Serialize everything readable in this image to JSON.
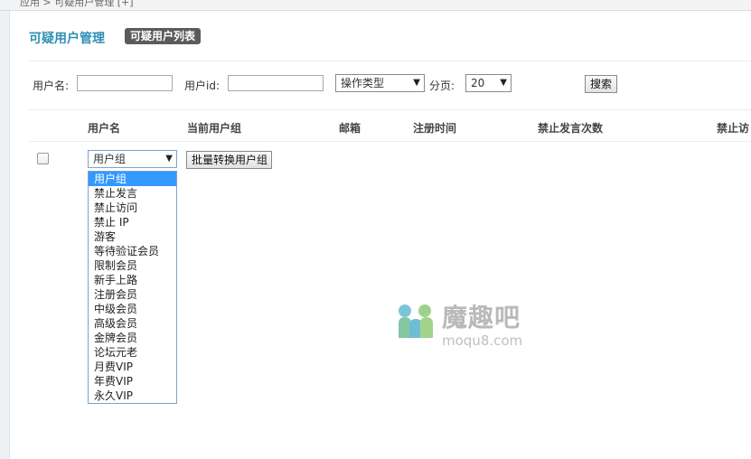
{
  "breadcrumb": "应用 > 可疑用户管理 [+]",
  "header": {
    "title": "可疑用户管理",
    "tab_label": "可疑用户列表"
  },
  "filters": {
    "username_label": "用户名:",
    "username_value": "",
    "userid_label": "用户id:",
    "userid_value": "",
    "op_type_selected": "操作类型",
    "page_label": "分页:",
    "page_size_selected": "20",
    "search_button": "搜索"
  },
  "table": {
    "columns": [
      "用户名",
      "当前用户组",
      "邮箱",
      "注册时间",
      "禁止发言次数",
      "禁止访"
    ]
  },
  "batch": {
    "group_select_value": "用户组",
    "convert_button": "批量转换用户组",
    "group_options": [
      "用户组",
      "禁止发言",
      "禁止访问",
      "禁止 IP",
      "游客",
      "等待验证会员",
      "限制会员",
      "新手上路",
      "注册会员",
      "中级会员",
      "高级会员",
      "金牌会员",
      "论坛元老",
      "月费VIP",
      "年费VIP",
      "永久VIP"
    ],
    "selected_index": 0
  },
  "watermark": {
    "name": "魔趣吧",
    "url": "moqu8.com"
  },
  "colors": {
    "accent": "#2f8fb4",
    "tab_bg": "#5b5b5b",
    "dropdown_highlight": "#3399ff"
  }
}
